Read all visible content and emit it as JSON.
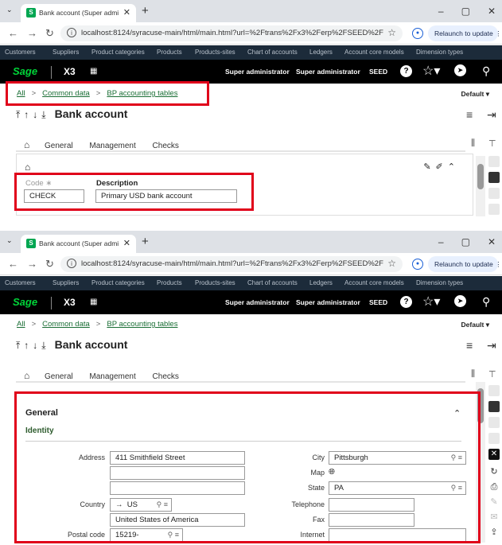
{
  "browser": {
    "tab_title": "Bank account (Super administra",
    "url": "localhost:8124/syracuse-main/html/main.html?url=%2Ftrans%2Fx3%2Ferp%2FSEED%2F%24sessio...",
    "relaunch_label": "Relaunch to update"
  },
  "menu": [
    "Customers",
    "Suppliers",
    "Product categories",
    "Products",
    "Products-sites",
    "Chart of accounts",
    "Ledgers",
    "Account core models",
    "Dimension types"
  ],
  "app": {
    "logo": "Sage",
    "product": "X3",
    "user": "Super administrator",
    "role": "Super administrator",
    "folder": "SEED"
  },
  "breadcrumb": {
    "all": "All",
    "common": "Common data",
    "tables": "BP accounting tables"
  },
  "view_selector": "Default",
  "page_title": "Bank account",
  "tabs": [
    "General",
    "Management",
    "Checks"
  ],
  "form1": {
    "code_label": "Code",
    "code_value": "CHECK",
    "desc_label": "Description",
    "desc_value": "Primary USD bank account"
  },
  "form2": {
    "section_title": "General",
    "subsection_title": "Identity",
    "address_label": "Address",
    "address_line1": "411 Smithfield Street",
    "address_line2": "",
    "address_line3": "",
    "country_label": "Country",
    "country_code": "US",
    "country_name": "United States of America",
    "postal_label": "Postal code",
    "postal_value": "15219-",
    "city_label": "City",
    "city_value": "Pittsburgh",
    "map_label": "Map",
    "state_label": "State",
    "state_value": "PA",
    "telephone_label": "Telephone",
    "telephone_value": "",
    "fax_label": "Fax",
    "fax_value": "",
    "internet_label": "Internet",
    "internet_value": ""
  },
  "colors": {
    "highlight": "#e0001a",
    "link": "#1a6e35",
    "menubar": "#1c2b3a"
  }
}
